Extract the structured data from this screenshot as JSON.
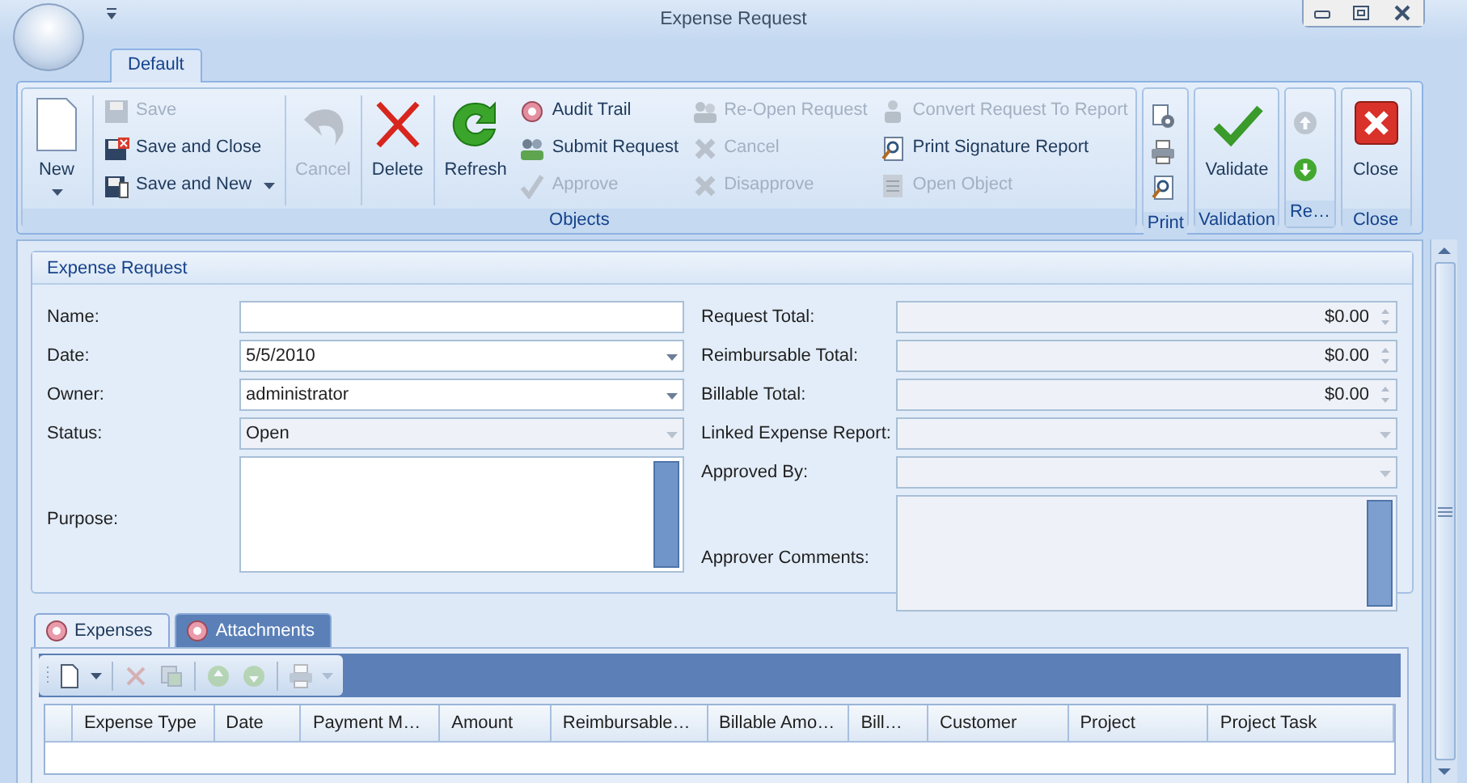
{
  "window": {
    "title": "Expense Request"
  },
  "ribbon": {
    "tabs": [
      {
        "label": "Default",
        "selected": true
      }
    ],
    "groups": [
      {
        "label": "Objects",
        "columns": [
          [
            {
              "kind": "large",
              "label": "New",
              "dropdown": true,
              "disabled": false
            }
          ],
          [
            {
              "kind": "small",
              "label": "Save",
              "disabled": true
            },
            {
              "kind": "small",
              "label": "Save and Close",
              "disabled": false
            },
            {
              "kind": "small",
              "label": "Save and New",
              "dropdown": true,
              "disabled": false
            }
          ],
          [
            {
              "kind": "large",
              "label": "Cancel",
              "disabled": true
            }
          ],
          [
            {
              "kind": "large",
              "label": "Delete",
              "disabled": false
            }
          ],
          [
            {
              "kind": "large",
              "label": "Refresh",
              "disabled": false
            }
          ],
          [
            {
              "kind": "small",
              "label": "Audit Trail",
              "disabled": false
            },
            {
              "kind": "small",
              "label": "Submit Request",
              "disabled": false
            },
            {
              "kind": "small",
              "label": "Approve",
              "disabled": true
            }
          ],
          [
            {
              "kind": "small",
              "label": "Re-Open Request",
              "disabled": true
            },
            {
              "kind": "small",
              "label": "Cancel",
              "disabled": true
            },
            {
              "kind": "small",
              "label": "Disapprove",
              "disabled": true
            }
          ],
          [
            {
              "kind": "small",
              "label": "Convert Request To Report",
              "disabled": true
            },
            {
              "kind": "small",
              "label": "Print Signature Report",
              "disabled": false
            },
            {
              "kind": "small",
              "label": "Open Object",
              "disabled": true
            }
          ]
        ]
      },
      {
        "label": "Print",
        "columns": [
          [
            {
              "kind": "icon",
              "disabled": false
            },
            {
              "kind": "icon",
              "disabled": false
            },
            {
              "kind": "icon",
              "disabled": false
            }
          ]
        ]
      },
      {
        "label": "Validation",
        "columns": [
          [
            {
              "kind": "large",
              "label": "Validate",
              "disabled": false
            }
          ]
        ]
      },
      {
        "label": "Re…",
        "columns": [
          [
            {
              "kind": "icon",
              "disabled": true
            },
            {
              "kind": "icon",
              "disabled": false
            }
          ]
        ]
      },
      {
        "label": "Close",
        "columns": [
          [
            {
              "kind": "large",
              "label": "Close",
              "disabled": false
            }
          ]
        ]
      }
    ]
  },
  "form": {
    "title": "Expense Request",
    "left": [
      {
        "label": "Name:",
        "kind": "text",
        "disabled": false
      },
      {
        "label": "Date:",
        "kind": "dropdown",
        "value": "5/5/2010",
        "disabled": false
      },
      {
        "label": "Owner:",
        "kind": "dropdown",
        "value": "administrator",
        "disabled": false
      },
      {
        "label": "Status:",
        "kind": "dropdown",
        "value": "Open",
        "disabled": true
      },
      {
        "label": "Purpose:",
        "kind": "memo",
        "disabled": false
      }
    ],
    "right": [
      {
        "label": "Request Total:",
        "kind": "spin",
        "value": "$0.00",
        "disabled": true
      },
      {
        "label": "Reimbursable Total:",
        "kind": "spin",
        "value": "$0.00",
        "disabled": true
      },
      {
        "label": "Billable Total:",
        "kind": "spin",
        "value": "$0.00",
        "disabled": true
      },
      {
        "label": "Linked Expense Report:",
        "kind": "dropdown",
        "disabled": true
      },
      {
        "label": "Approved By:",
        "kind": "dropdown",
        "disabled": true
      },
      {
        "label": "Approver Comments:",
        "kind": "memo",
        "disabled": true
      }
    ]
  },
  "detail_tabs": [
    {
      "label": "Expenses",
      "selected": true
    },
    {
      "label": "Attachments",
      "selected": false
    }
  ],
  "toolbar": [
    {
      "dropdown": true,
      "disabled": false
    },
    {
      "disabled": true
    },
    {
      "disabled": true
    },
    {
      "disabled": true
    },
    {
      "disabled": true
    },
    {
      "dropdown": true,
      "disabled": true
    }
  ],
  "table": {
    "columns": [
      "Expense Type",
      "Date",
      "Payment M…",
      "Amount",
      "Reimbursable…",
      "Billable Amo…",
      "Bill…",
      "Customer",
      "Project",
      "Project Task"
    ]
  }
}
